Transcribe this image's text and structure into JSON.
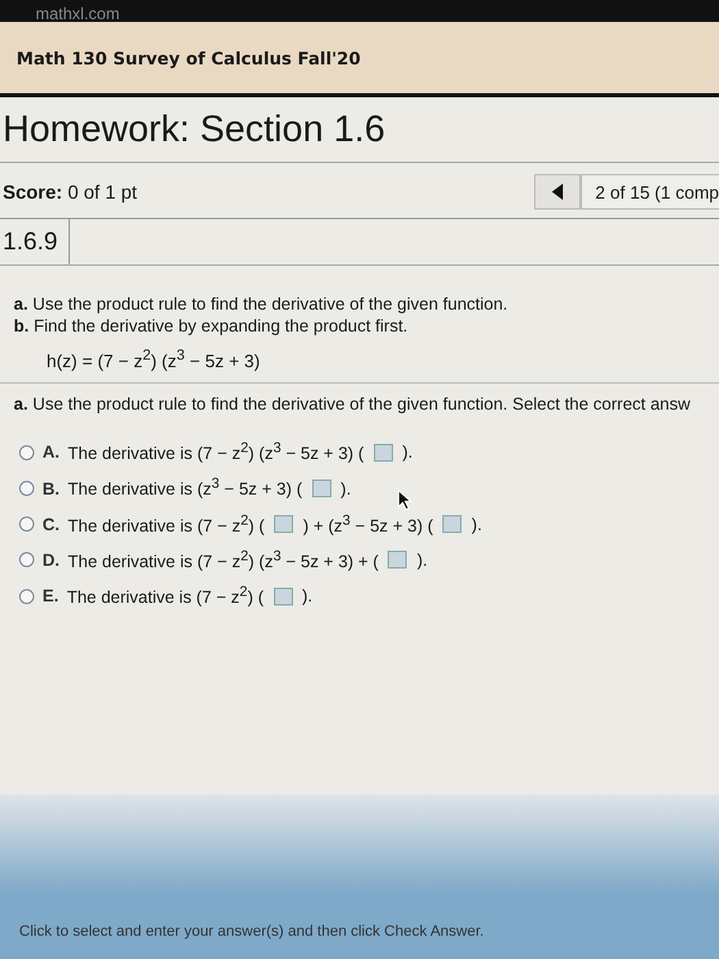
{
  "browser": {
    "url": "mathxl.com"
  },
  "course": {
    "title": "Math 130 Survey of Calculus Fall'20"
  },
  "homework": {
    "title": "Homework: Section 1.6"
  },
  "score": {
    "label": "Score:",
    "value": "0 of 1 pt"
  },
  "navigation": {
    "position": "2 of 15 (1 comp"
  },
  "question": {
    "number": "1.6.9",
    "instructions": [
      "**a.** Use the product rule to find the derivative of the given function.",
      "**b.** Find the derivative by expanding the product first."
    ],
    "function": "h(z) = (7 − z$^{2}$) (z$^{3}$ − 5z + 3)",
    "part_a": "**a.** Use the product rule to find the derivative of the given function. Select the correct answ",
    "options": [
      {
        "letter": "A.",
        "selected": false,
        "parts": [
          {
            "kind": "text",
            "text": "The derivative is (7 − z$^{2}$) (z$^{3}$ − 5z + 3) ("
          },
          {
            "kind": "box"
          },
          {
            "kind": "text",
            "text": ")."
          }
        ]
      },
      {
        "letter": "B.",
        "selected": false,
        "parts": [
          {
            "kind": "text",
            "text": "The derivative is (z$^{3}$ − 5z + 3) ("
          },
          {
            "kind": "box"
          },
          {
            "kind": "text",
            "text": ")."
          }
        ]
      },
      {
        "letter": "C.",
        "selected": false,
        "parts": [
          {
            "kind": "text",
            "text": "The derivative is (7 − z$^{2}$) ("
          },
          {
            "kind": "box"
          },
          {
            "kind": "text",
            "text": ") + (z$^{3}$ − 5z + 3) ("
          },
          {
            "kind": "box"
          },
          {
            "kind": "text",
            "text": ")."
          }
        ]
      },
      {
        "letter": "D.",
        "selected": false,
        "parts": [
          {
            "kind": "text",
            "text": "The derivative is (7 − z$^{2}$) (z$^{3}$ − 5z + 3) + ("
          },
          {
            "kind": "box"
          },
          {
            "kind": "text",
            "text": ")."
          }
        ]
      },
      {
        "letter": "E.",
        "selected": false,
        "parts": [
          {
            "kind": "text",
            "text": "The derivative is (7 − z$^{2}$) ("
          },
          {
            "kind": "box"
          },
          {
            "kind": "text",
            "text": ")."
          }
        ]
      }
    ]
  },
  "footer": {
    "hint": "Click to select and enter your answer(s) and then click Check Answer."
  }
}
